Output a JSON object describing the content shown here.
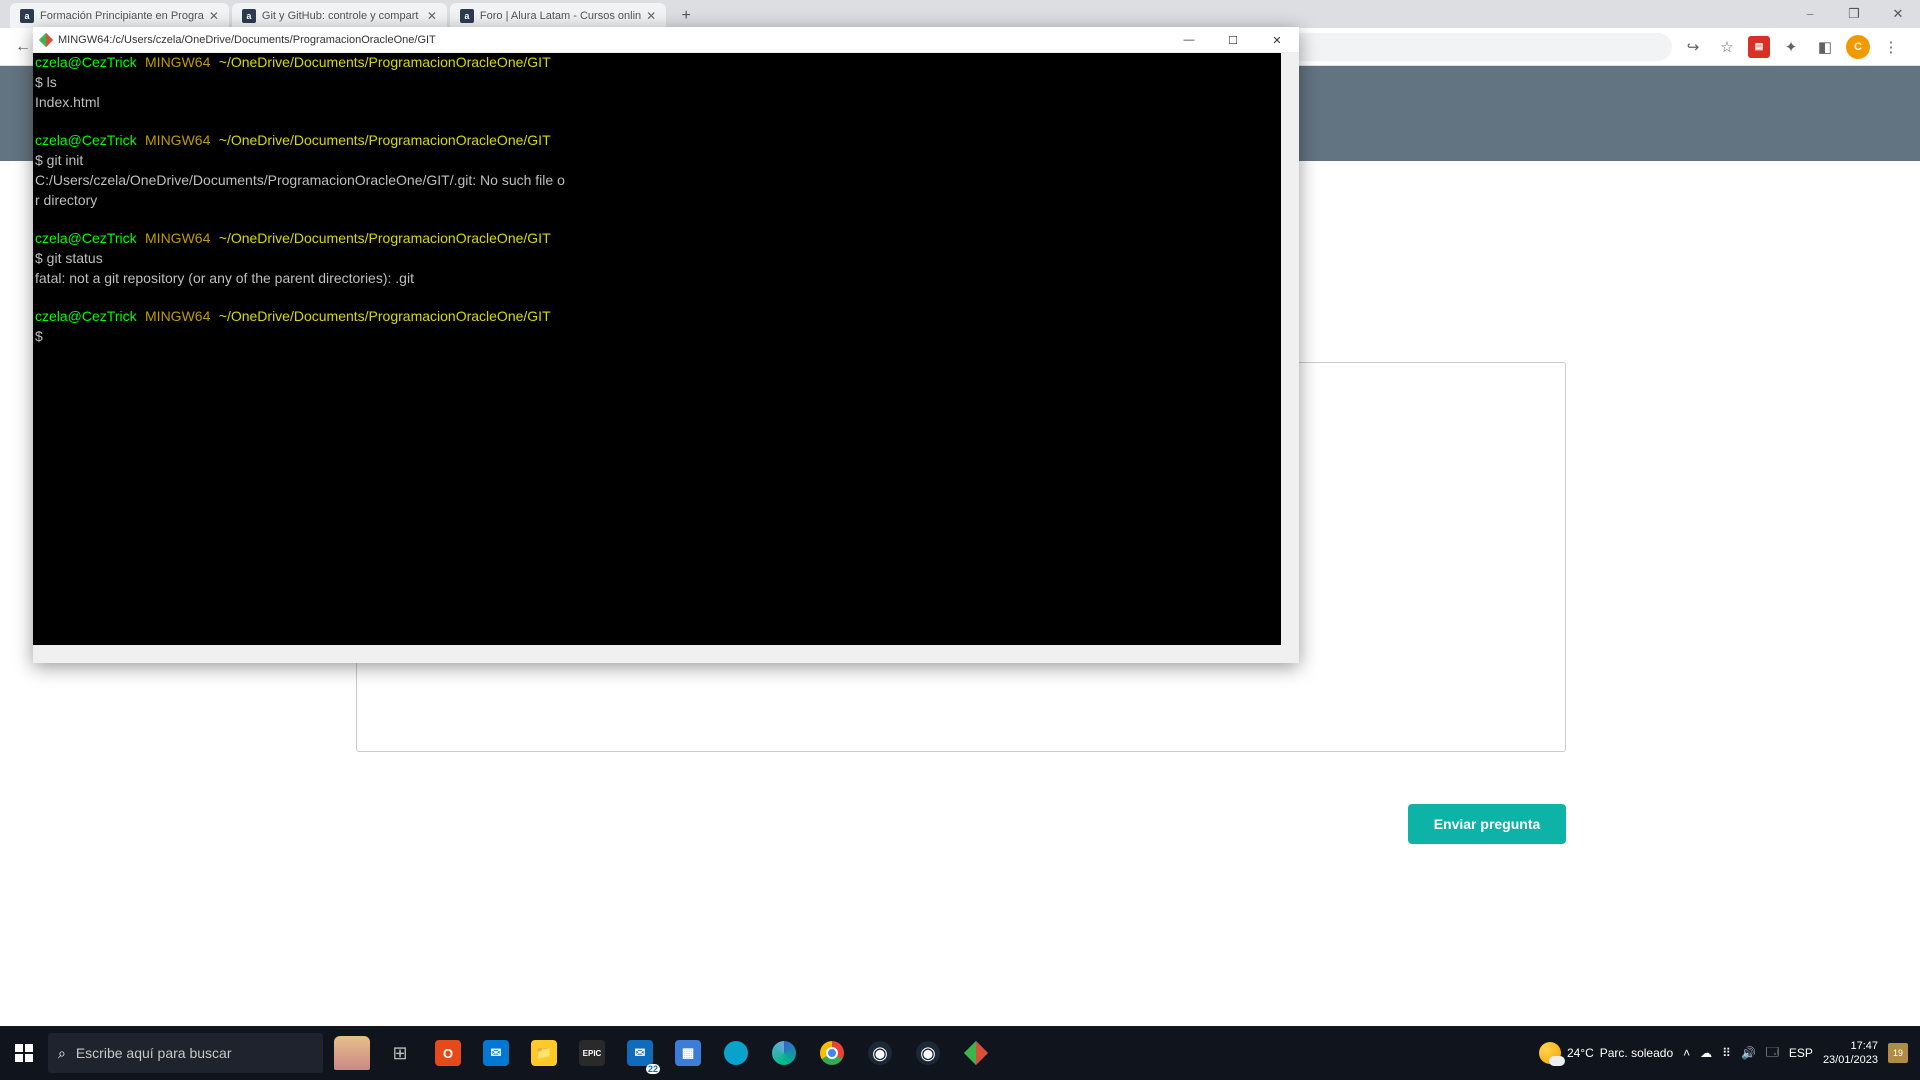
{
  "browser": {
    "tabs": [
      {
        "favicon": "a",
        "title": "Formación Principiante en Progra"
      },
      {
        "favicon": "a",
        "title": "Git y GitHub: controle y compart"
      },
      {
        "favicon": "a",
        "title": "Foro | Alura Latam - Cursos onlin"
      }
    ],
    "window_controls": {
      "minimize": "—",
      "maximize": "▢",
      "close": "✕"
    },
    "toolbar_icons": {
      "share": "↗",
      "star": "☆",
      "pdf": "▤",
      "extensions": "✱",
      "side": "◧",
      "avatar": "C",
      "menu": "⋮"
    }
  },
  "page": {
    "submit_label": "Enviar pregunta"
  },
  "terminal": {
    "title": "MINGW64:/c/Users/czela/OneDrive/Documents/ProgramacionOracleOne/GIT",
    "controls": {
      "minimize": "—",
      "maximize": "☐",
      "close": "✕"
    },
    "prompt": {
      "user": "czela@CezTrick",
      "env": "MINGW64",
      "path": "~/OneDrive/Documents/ProgramacionOracleOne/GIT",
      "ps1": "$"
    },
    "blocks": [
      {
        "cmd": "ls",
        "out": "Index.html"
      },
      {
        "cmd": "git init",
        "out": "C:/Users/czela/OneDrive/Documents/ProgramacionOracleOne/GIT/.git: No such file o\nr directory"
      },
      {
        "cmd": "git status",
        "out": "fatal: not a git repository (or any of the parent directories): .git"
      },
      {
        "cmd": "",
        "out": ""
      }
    ]
  },
  "taskbar": {
    "search_placeholder": "Escribe aquí para buscar",
    "weather_temp": "24°C",
    "weather_label": "Parc. soleado",
    "lang": "ESP",
    "time": "17:47",
    "date": "23/01/2023",
    "notification_count": "19"
  }
}
